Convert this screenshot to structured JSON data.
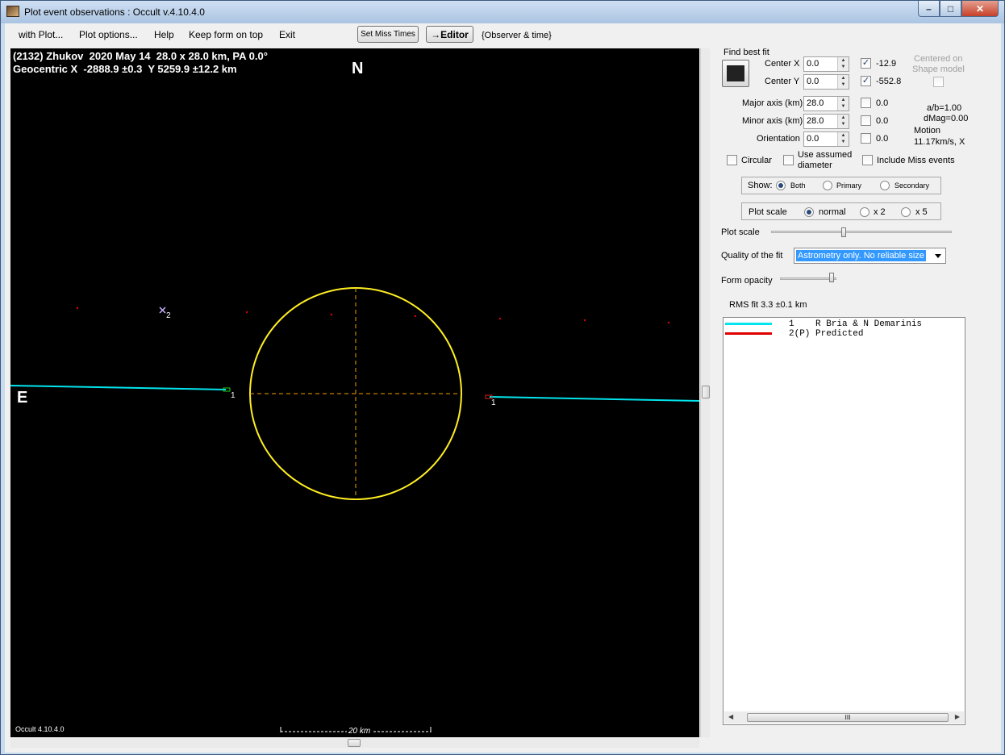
{
  "window": {
    "title": "Plot event observations : Occult v.4.10.4.0",
    "controls": {
      "minimize": "–",
      "maximize": "□",
      "close": "✕"
    }
  },
  "menu": {
    "items": [
      "with Plot...",
      "Plot options...",
      "Help",
      "Keep form on top",
      "Exit"
    ],
    "set_miss_times": "Set Miss Times",
    "editor": "→Editor",
    "observer_time": "{Observer & time}"
  },
  "plot": {
    "header_line1": "(2132) Zhukov  2020 May 14  28.0 x 28.0 km, PA 0.0°",
    "header_line2": "Geocentric X  -2888.9 ±0.3  Y 5259.9 ±12.2 km",
    "north_label": "N",
    "east_label": "E",
    "version": "Occult 4.10.4.0",
    "scale_label": "20 km",
    "chord_label_1a": "1",
    "chord_label_1b": "1",
    "predicted_label": "2",
    "colors": {
      "ellipse": "#ffee22",
      "axes": "#f0a000",
      "chord1": "#00e5ee",
      "predicted": "#e00000"
    }
  },
  "panel": {
    "find_best_fit": "Find best fit",
    "center_x": {
      "label": "Center X",
      "value": "0.0",
      "checked": true,
      "fit": "-12.9"
    },
    "center_y": {
      "label": "Center Y",
      "value": "0.0",
      "checked": true,
      "fit": "-552.8"
    },
    "major_axis": {
      "label": "Major axis (km)",
      "value": "28.0",
      "checked": false,
      "fit": "0.0"
    },
    "minor_axis": {
      "label": "Minor axis (km)",
      "value": "28.0",
      "checked": false,
      "fit": "0.0"
    },
    "orientation": {
      "label": "Orientation",
      "value": "0.0",
      "checked": false,
      "fit": "0.0"
    },
    "centered_on_shape": "Centered on",
    "centered_on_shape_2": "Shape model",
    "ab_ratio": "a/b=1.00",
    "dmag": "dMag=0.00",
    "motion": "Motion",
    "motion_value": "11.17km/s, X",
    "circular": "Circular",
    "use_assumed": "Use assumed",
    "use_assumed_2": "diameter",
    "include_miss": "Include Miss events",
    "show_label": "Show:",
    "show_options": [
      "Both",
      "Primary",
      "Secondary"
    ],
    "show_selected": "Both",
    "plot_scale_label": "Plot scale",
    "plot_scale_options": [
      "normal",
      "x 2",
      "x 5"
    ],
    "plot_scale_selected": "normal",
    "plot_scale_slider_label": "Plot scale",
    "plot_scale_slider_level": 0.4,
    "quality_label": "Quality of the fit",
    "quality_value": "Astrometry only. No reliable size",
    "form_opacity_label": "Form opacity",
    "form_opacity_level": 0.95,
    "rms_fit": "RMS fit 3.3 ±0.1 km",
    "legend": [
      {
        "text": "1    R Bria & N Demarinis",
        "color": "#00e5ee"
      },
      {
        "text": "2(P) Predicted",
        "color": "#e00000"
      }
    ],
    "legend_scroll_grip": "III"
  }
}
